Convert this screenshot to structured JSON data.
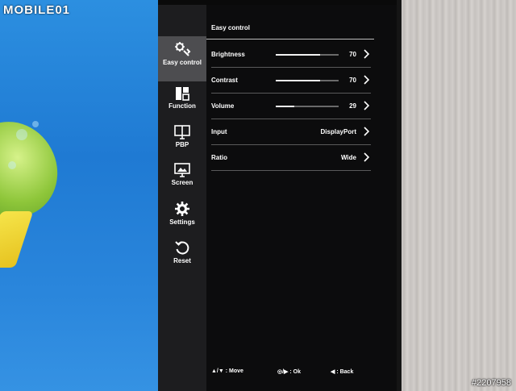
{
  "watermark": "MOBILE01",
  "photo_id": "#2207958",
  "osd": {
    "sidebar": [
      {
        "label": "Easy control",
        "icon": "wrench-settings-icon",
        "active": true
      },
      {
        "label": "Function",
        "icon": "function-grid-icon",
        "active": false
      },
      {
        "label": "PBP",
        "icon": "pbp-monitor-icon",
        "active": false
      },
      {
        "label": "Screen",
        "icon": "screen-monitor-icon",
        "active": false
      },
      {
        "label": "Settings",
        "icon": "gear-icon",
        "active": false
      },
      {
        "label": "Reset",
        "icon": "reset-icon",
        "active": false
      }
    ],
    "title": "Easy control",
    "rows": [
      {
        "label": "Brightness",
        "value": "70",
        "level": 70
      },
      {
        "label": "Contrast",
        "value": "70",
        "level": 70
      },
      {
        "label": "Volume",
        "value": "29",
        "level": 29
      },
      {
        "label": "Input",
        "value": "DisplayPort"
      },
      {
        "label": "Ratio",
        "value": "Wide"
      }
    ],
    "footer": {
      "move": "▲/▼ : Move",
      "ok": "◎/▶ : Ok",
      "back": "◀ : Back"
    }
  }
}
